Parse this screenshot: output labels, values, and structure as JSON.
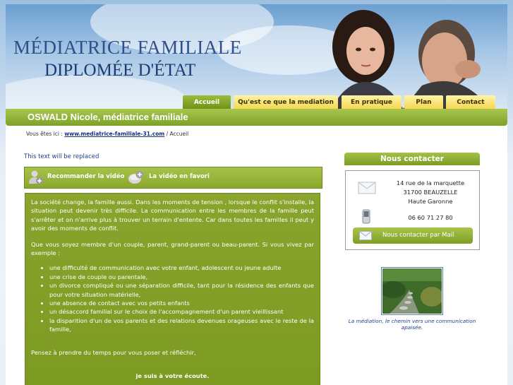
{
  "header": {
    "title_line1": "MÉDIATRICE FAMILIALE",
    "title_line2": "DIPLOMÉE D'ÉTAT"
  },
  "nav": {
    "items": [
      {
        "label": "Accueil",
        "active": true
      },
      {
        "label": "Qu'est ce que la mediation",
        "active": false
      },
      {
        "label": "En pratique",
        "active": false
      },
      {
        "label": "Plan",
        "active": false
      },
      {
        "label": "Contact",
        "active": false
      }
    ]
  },
  "banner": {
    "title": "OSWALD Nicole, médiatrice familiale"
  },
  "breadcrumb": {
    "prefix": "Vous êtes ici : ",
    "link": "www.mediatrice-familiale-31.com",
    "separator": " / ",
    "current": "Accueil"
  },
  "main": {
    "placeholder_text": "This text will be replaced",
    "actions": {
      "recommend": "Recommander la vidéo",
      "favorite": "La vidéo en favori"
    },
    "intro1": "La société change, la famille aussi. Dans les moments de tension , lorsque le conflit s'installe, la situation peut devenir très difficile. La communication entre les membres de la famille peut s'arrêter et on n'arrive plus à trouver un terrain d'entente. Car dans toutes les familles il peut y avoir des moments de conflit.",
    "intro2": "Que vous soyez membre d'un couple, parent, grand-parent ou beau-parent. Si vous vivez par exemple :",
    "list": [
      "une difficulté de communication avec votre enfant, adolescent ou jeune adulte",
      "une crise de couple ou parentale,",
      "un divorce compliqué ou une séparation difficile, tant pour la résidence des enfants que pour votre situation matérielle,",
      "une absence de contact avec vos petits enfants",
      "un désaccord familial sur le choix de l'accompagnement d'un parent vieillissant",
      "la disparition d'un de vos parents et des relations devenues orageuses avec le reste de la famille,"
    ],
    "think": "Pensez à prendre du temps pour vous poser et réfléchir,",
    "listen": "je suis à votre écoute."
  },
  "contact": {
    "title": "Nous contacter",
    "address_line1": "14 rue de la marquette",
    "address_line2": "31700 BEAUZELLE",
    "address_line3": "Haute Garonne",
    "phone": "06 60 71 27 80",
    "mail_button": "Nous contacter par Mail"
  },
  "photo_caption": "La médiation, le chemin vers une communication apaisée.",
  "colors": {
    "green_dark": "#7c9a22",
    "green_light": "#a8c64c",
    "nav_yellow": "#f5d64e",
    "title_blue": "#2f4f8a",
    "link_blue": "#1a2e7a"
  }
}
